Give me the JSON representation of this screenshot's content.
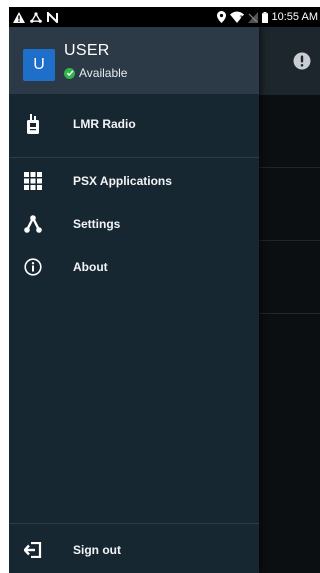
{
  "statusbar": {
    "left_icons": [
      "warning-icon",
      "network-triangle-icon",
      "nfc-icon"
    ],
    "right_icons": [
      "location-icon",
      "wifi-icon",
      "no-signal-icon",
      "battery-icon"
    ],
    "time": "10:55 AM"
  },
  "user": {
    "avatar_letter": "U",
    "name": "USER",
    "status": "Available",
    "status_color": "#2fb54a"
  },
  "menu": {
    "lmr": {
      "label": "LMR Radio",
      "icon": "radio-icon"
    },
    "psx": {
      "label": "PSX Applications",
      "icon": "grid-icon"
    },
    "settings": {
      "label": "Settings",
      "icon": "settings-nodes-icon"
    },
    "about": {
      "label": "About",
      "icon": "info-icon"
    },
    "signout": {
      "label": "Sign out",
      "icon": "sign-out-icon"
    }
  },
  "background_app": {
    "icon": "alert-icon"
  },
  "colors": {
    "drawer_bg": "#172732",
    "header_bg": "#2b3a46",
    "avatar_bg": "#1e6fc9"
  }
}
